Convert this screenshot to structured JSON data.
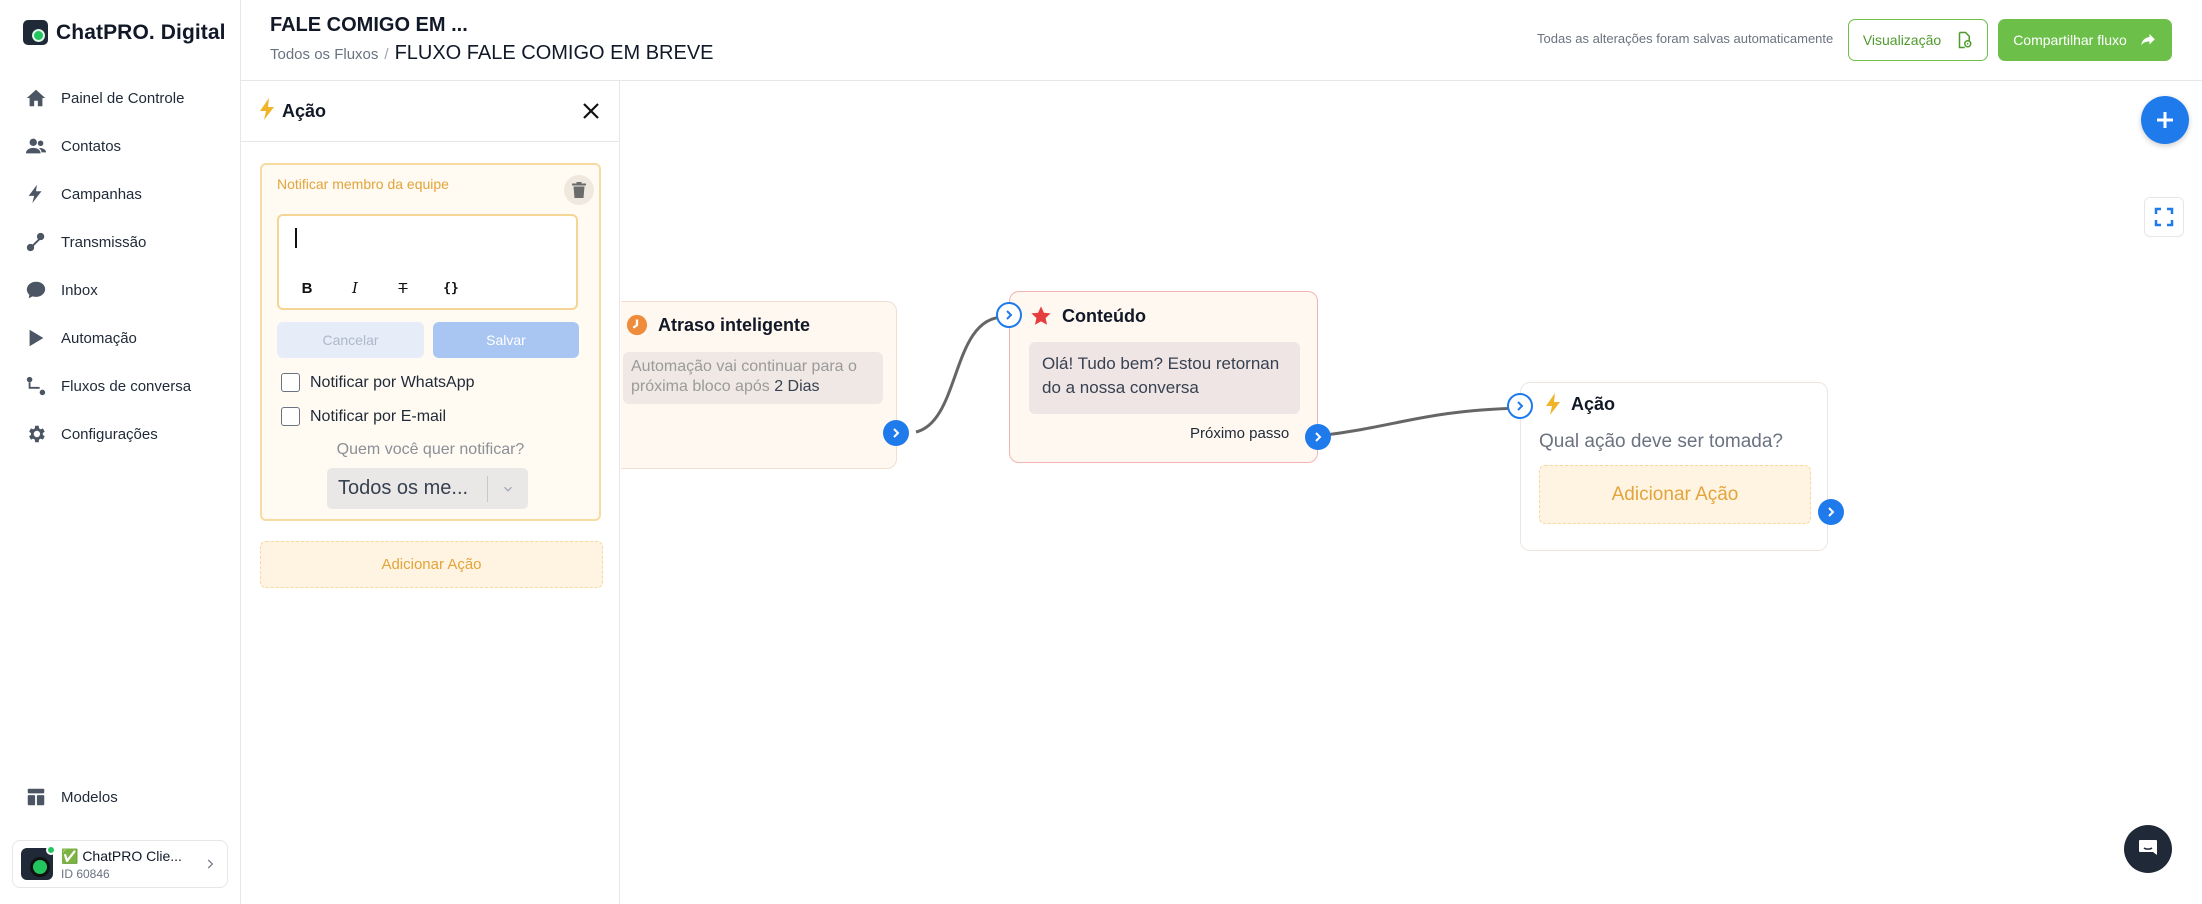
{
  "app": {
    "name": "ChatPRO. Digital"
  },
  "sidebar": {
    "items": [
      {
        "label": "Painel de Controle",
        "icon": "home-icon"
      },
      {
        "label": "Contatos",
        "icon": "contacts-icon"
      },
      {
        "label": "Campanhas",
        "icon": "campaign-icon"
      },
      {
        "label": "Transmissão",
        "icon": "broadcast-icon"
      },
      {
        "label": "Inbox",
        "icon": "inbox-icon"
      },
      {
        "label": "Automação",
        "icon": "automation-icon"
      },
      {
        "label": "Fluxos de conversa",
        "icon": "flows-icon"
      },
      {
        "label": "Configurações",
        "icon": "gear-icon"
      }
    ],
    "bottom_item": {
      "label": "Modelos",
      "icon": "templates-icon"
    },
    "account": {
      "name": "✅ ChatPRO Clie...",
      "id": "ID 60846"
    }
  },
  "header": {
    "title": "FALE COMIGO EM ...",
    "breadcrumb_root": "Todos os Fluxos",
    "breadcrumb_sep": "/",
    "breadcrumb_current": "FLUXO FALE COMIGO EM BREVE",
    "autosave": "Todas as alterações foram salvas automaticamente",
    "preview_label": "Visualização",
    "share_label": "Compartilhar fluxo"
  },
  "panel": {
    "title": "Ação",
    "notify_title": "Notificar membro da equipe",
    "editor_value": "",
    "cancel_label": "Cancelar",
    "save_label": "Salvar",
    "notify_whatsapp": "Notificar por WhatsApp",
    "notify_email": "Notificar por E-mail",
    "who_label": "Quem você quer notificar?",
    "who_value": "Todos os me...",
    "add_action": "Adicionar Ação"
  },
  "canvas": {
    "delay_node": {
      "title": "Atraso inteligente",
      "text_prefix": "Automação vai continuar para o próxima bloco após",
      "text_value": "2 Dias"
    },
    "content_node": {
      "title": "Conteúdo",
      "message": "Olá! Tudo bem? Estou retornando a nossa conversa",
      "next_label": "Próximo passo"
    },
    "action_node": {
      "title": "Ação",
      "question": "Qual ação deve ser tomada?",
      "add_action": "Adicionar Ação"
    }
  },
  "colors": {
    "accent_blue": "#1f7aec",
    "brand_green": "#6cc04a",
    "warning_orange": "#e2a43b",
    "delay_orange": "#ef8c3b",
    "content_red": "#e53e3e"
  }
}
